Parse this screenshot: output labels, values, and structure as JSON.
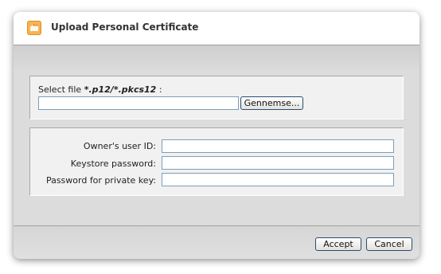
{
  "dialog": {
    "title": "Upload Personal Certificate",
    "icon": "certificate-upload-icon"
  },
  "file_section": {
    "label_prefix": "Select file ",
    "label_ext": "*.p12/*.pkcs12",
    "label_suffix": " :",
    "file_value": "",
    "browse_label": "Gennemse..."
  },
  "credentials": {
    "user_id_label": "Owner's user ID:",
    "user_id_value": "",
    "keystore_password_label": "Keystore password:",
    "keystore_password_value": "",
    "private_key_password_label": "Password for private key:",
    "private_key_password_value": ""
  },
  "footer": {
    "accept_label": "Accept",
    "cancel_label": "Cancel"
  },
  "colors": {
    "accent_orange": "#f2a23a",
    "button_border": "#2a4d73",
    "input_border": "#7f9db9"
  }
}
